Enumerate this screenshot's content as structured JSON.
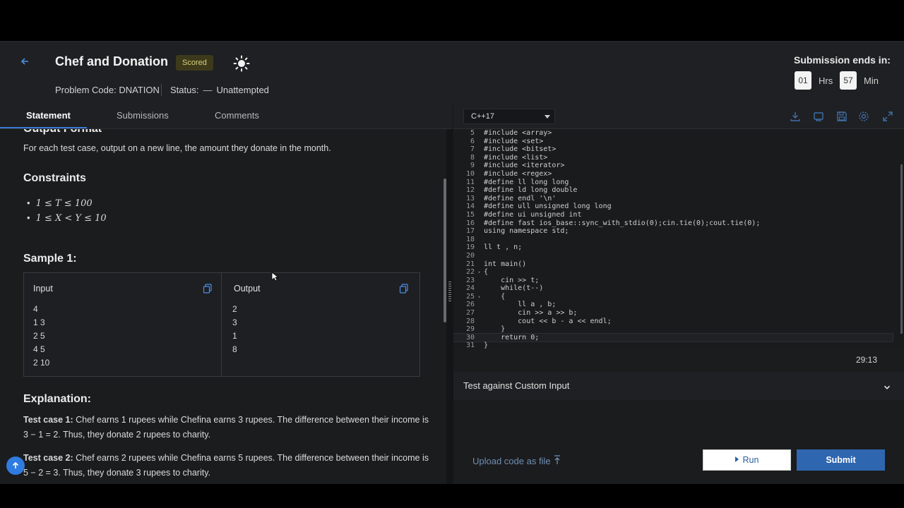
{
  "header": {
    "back_icon": "arrow-left-icon",
    "title": "Chef and Donation",
    "badge": "Scored",
    "theme_icon": "sun-icon",
    "problem_code": "Problem Code: DNATION",
    "status_label": "Status:",
    "status_dash": "—",
    "status_value": "Unattempted",
    "timer_label": "Submission ends in:",
    "hours": "01",
    "hours_unit": "Hrs",
    "minutes": "57",
    "minutes_unit": "Min"
  },
  "tabs": [
    {
      "label": "Statement",
      "active": true
    },
    {
      "label": "Submissions",
      "active": false
    },
    {
      "label": "Comments",
      "active": false
    }
  ],
  "statement": {
    "output_format_heading": "Output Format",
    "output_format_text": "For each test case, output on a new line, the amount they donate in the month.",
    "constraints_heading": "Constraints",
    "constraints": [
      "1 ≤ T ≤ 100",
      "1 ≤ X < Y ≤ 10"
    ],
    "sample_heading": "Sample 1:",
    "sample_input_label": "Input",
    "sample_output_label": "Output",
    "sample_input_lines": [
      "4",
      "1 3",
      "2 5",
      "4 5",
      "2 10"
    ],
    "sample_output_lines": [
      "2",
      "3",
      "1",
      "8"
    ],
    "explanation_heading": "Explanation:",
    "test1_label": "Test case 1:",
    "test1_line1": "Chef earns 1 rupees while Chefina earns 3 rupees. The difference between their income is",
    "test1_line2": "3 − 1 = 2. Thus, they donate 2 rupees to charity.",
    "test2_label": "Test case 2:",
    "test2_line1": "Chef earns 2 rupees while Chefina earns 5 rupees. The difference between their income is",
    "test2_line2": "5 − 2 = 3. Thus, they donate 3 rupees to charity."
  },
  "editor": {
    "language": "C++17",
    "toolbar_icons": [
      "download-icon",
      "console-icon",
      "save-icon",
      "settings-icon",
      "expand-icon"
    ],
    "lines": [
      {
        "n": "5",
        "code": "#include <array>"
      },
      {
        "n": "6",
        "code": "#include <set>"
      },
      {
        "n": "7",
        "code": "#include <bitset>"
      },
      {
        "n": "8",
        "code": "#include <list>"
      },
      {
        "n": "9",
        "code": "#include <iterator>"
      },
      {
        "n": "10",
        "code": "#include <regex>"
      },
      {
        "n": "11",
        "code": "#define ll long long"
      },
      {
        "n": "12",
        "code": "#define ld long double"
      },
      {
        "n": "13",
        "code": "#define endl '\\n'"
      },
      {
        "n": "14",
        "code": "#define ull unsigned long long"
      },
      {
        "n": "15",
        "code": "#define ui unsigned int"
      },
      {
        "n": "16",
        "code": "#define fast ios_base::sync_with_stdio(0);cin.tie(0);cout.tie(0);"
      },
      {
        "n": "17",
        "code": "using namespace std;"
      },
      {
        "n": "18",
        "code": ""
      },
      {
        "n": "19",
        "code": "ll t , n;"
      },
      {
        "n": "20",
        "code": ""
      },
      {
        "n": "21",
        "code": "int main()"
      },
      {
        "n": "22",
        "code": "{"
      },
      {
        "n": "23",
        "code": "    cin >> t;"
      },
      {
        "n": "24",
        "code": "    while(t--)"
      },
      {
        "n": "25",
        "code": "    {"
      },
      {
        "n": "26",
        "code": "        ll a , b;"
      },
      {
        "n": "27",
        "code": "        cin >> a >> b;"
      },
      {
        "n": "28",
        "code": "        cout << b - a << endl;"
      },
      {
        "n": "29",
        "code": "    }"
      },
      {
        "n": "30",
        "code": "    return 0;"
      },
      {
        "n": "31",
        "code": "}"
      }
    ],
    "cursor_position": "29:13"
  },
  "custom_input": {
    "label": "Test against Custom Input"
  },
  "actions": {
    "upload_label": "Upload code as file",
    "run_label": "Run",
    "submit_label": "Submit"
  },
  "colors": {
    "accent": "#2f66b0",
    "background": "#1b1c1e",
    "badge_bg": "#3d3a1c"
  }
}
